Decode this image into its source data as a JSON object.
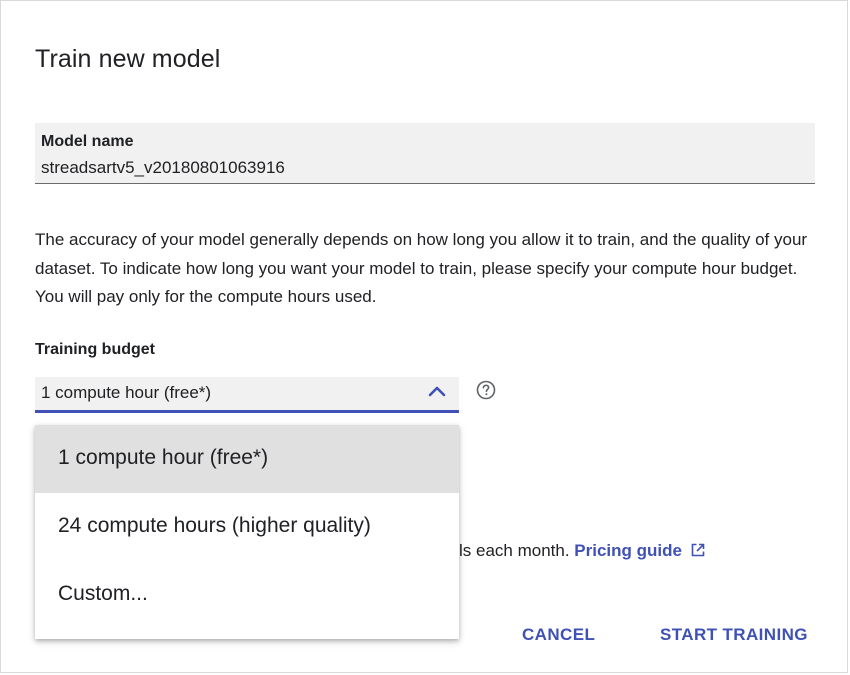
{
  "dialog": {
    "title": "Train new model"
  },
  "model_name": {
    "label": "Model name",
    "value": "streadsartv5_v20180801063916"
  },
  "description": "The accuracy of your model generally depends on how long you allow it to train, and the quality of your dataset. To indicate how long you want your model to train, please specify your compute hour budget. You will pay only for the compute hours used.",
  "training_budget": {
    "label": "Training budget",
    "selected": "1 compute hour (free*)",
    "options": [
      {
        "label": "1 compute hour (free*)",
        "selected": true
      },
      {
        "label": "24 compute hours (higher quality)",
        "selected": false
      },
      {
        "label": "Custom...",
        "selected": false
      }
    ]
  },
  "footnote": {
    "partial_text": "ls each month.",
    "link_label": "Pricing guide"
  },
  "actions": {
    "cancel_label": "CANCEL",
    "start_label": "START TRAINING"
  },
  "colors": {
    "accent": "#3f51b5",
    "field_bg": "#f1f1f1",
    "selected_item_bg": "#e0e0e0"
  },
  "icons": {
    "select_chevron": "chevron-up-icon",
    "help": "help-circle-icon",
    "external_link": "open-in-new-icon"
  }
}
